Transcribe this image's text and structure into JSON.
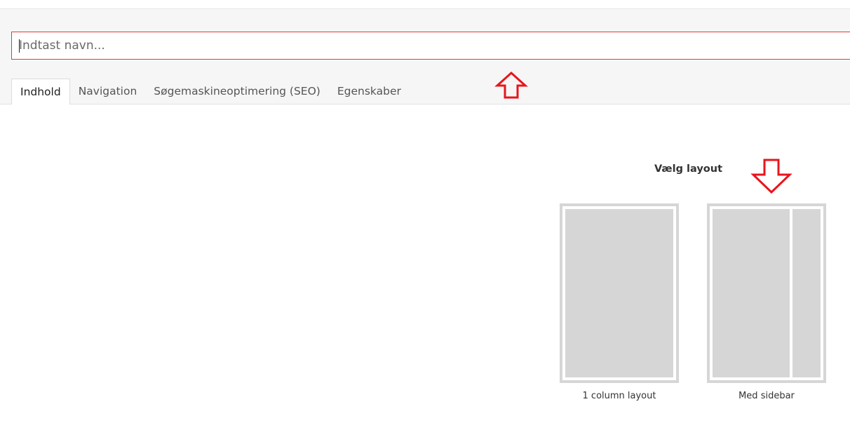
{
  "header": {
    "name_input": {
      "placeholder": "Indtast navn..."
    },
    "tabs": [
      {
        "label": "Indhold",
        "active": true
      },
      {
        "label": "Navigation",
        "active": false
      },
      {
        "label": "Søgemaskineoptimering (SEO)",
        "active": false
      },
      {
        "label": "Egenskaber",
        "active": false
      }
    ]
  },
  "layout_picker": {
    "title": "Vælg layout",
    "options": [
      {
        "label": "1 column layout",
        "columns": 1
      },
      {
        "label": "Med sidebar",
        "columns": 2
      }
    ]
  },
  "annotations": [
    {
      "icon": "arrow-up-icon",
      "color": "#e8151b"
    },
    {
      "icon": "arrow-down-icon",
      "color": "#e8151b"
    }
  ],
  "colors": {
    "annotation": "#e8151b",
    "input_border": "#e53935",
    "thumb": "#d6d6d6",
    "header_bg": "#f6f6f6"
  }
}
